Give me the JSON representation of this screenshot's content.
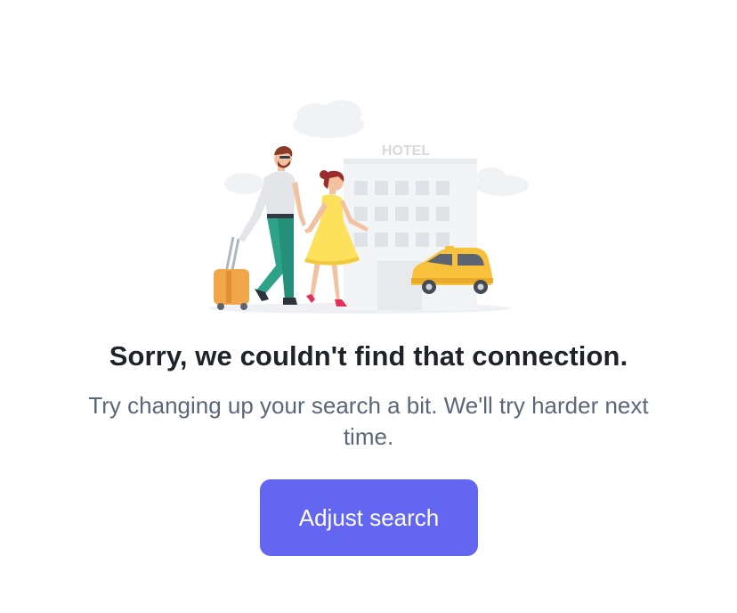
{
  "empty_state": {
    "illustration_sign": "HOTEL",
    "title": "Sorry, we couldn't find that connection.",
    "message": "Try changing up your search a bit. We'll try harder next time.",
    "action_label": "Adjust search"
  },
  "colors": {
    "accent": "#6366f1",
    "title": "#1f2329",
    "message": "#5b6778",
    "taxi": "#f7c13b"
  }
}
